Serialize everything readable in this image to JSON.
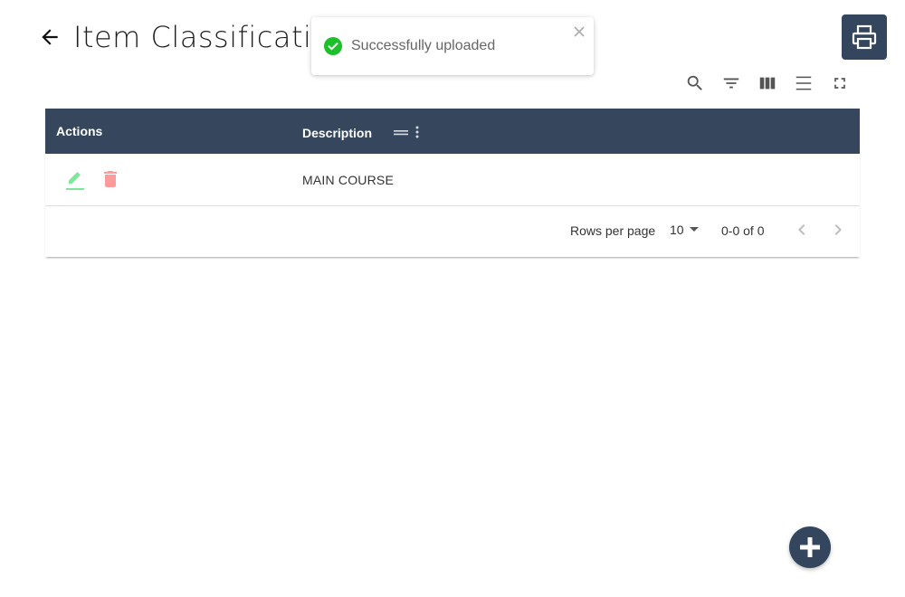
{
  "header": {
    "title": "Item Classificatio",
    "back_icon": "arrow-left-icon",
    "print_icon": "printer-icon"
  },
  "toast": {
    "message": "Successfully uploaded",
    "status_icon": "check-circle-icon",
    "close_icon": "close-icon",
    "color": "#1dbf2a"
  },
  "toolbar": {
    "icons": [
      "search-icon",
      "filter-icon",
      "columns-icon",
      "density-icon",
      "fullscreen-icon"
    ]
  },
  "table": {
    "columns": [
      "Actions",
      "Description"
    ],
    "rows": [
      {
        "description": "MAIN COURSE",
        "edit_icon": "pencil-icon",
        "delete_icon": "trash-icon"
      }
    ],
    "header_color": "#36475d"
  },
  "pagination": {
    "rows_per_page_label": "Rows per page",
    "rows_per_page_value": "10",
    "range_text": "0-0 of 0"
  },
  "fab": {
    "icon": "plus-icon"
  },
  "colors": {
    "accent": "#34465d",
    "edit": "#7ee89a",
    "delete": "#ff9a9a"
  }
}
